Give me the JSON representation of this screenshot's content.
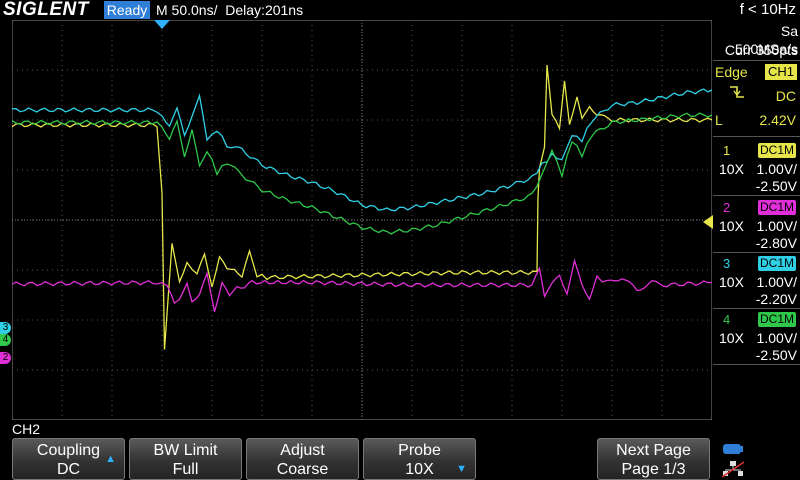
{
  "topbar": {
    "logo": "SIGLENT",
    "status": "Ready",
    "timebase": "M 50.0ns/  Delay:201ns",
    "frequency": "f < 10Hz"
  },
  "acquisition": {
    "sample_rate": "Sa 500MSa/s",
    "memory": "Curr 350pts"
  },
  "trigger": {
    "type": "Edge",
    "source": "CH1",
    "slope_icon": "falling-edge-icon",
    "coupling": "DC",
    "mode": "L",
    "level": "2.42V"
  },
  "channels": [
    {
      "num": "1",
      "coupling": "DC1M",
      "probe": "10X",
      "scale": "1.00V/",
      "offset": "-2.50V",
      "color": "#e6e64a"
    },
    {
      "num": "2",
      "coupling": "DC1M",
      "probe": "10X",
      "scale": "1.00V/",
      "offset": "-2.80V",
      "color": "#e02fd8"
    },
    {
      "num": "3",
      "coupling": "DC1M",
      "probe": "10X",
      "scale": "1.00V/",
      "offset": "-2.20V",
      "color": "#2fd0e6"
    },
    {
      "num": "4",
      "coupling": "DC1M",
      "probe": "10X",
      "scale": "1.00V/",
      "offset": "-2.50V",
      "color": "#2fc84a"
    }
  ],
  "markers": {
    "ch3": "3",
    "ch4": "4",
    "ch2": "2"
  },
  "menu": {
    "title": "CH2",
    "coupling": {
      "label": "Coupling",
      "value": "DC"
    },
    "bw_limit": {
      "label": "BW Limit",
      "value": "Full"
    },
    "adjust": {
      "label": "Adjust",
      "value": "Coarse"
    },
    "probe": {
      "label": "Probe",
      "value": "10X"
    },
    "next_page": {
      "label": "Next Page",
      "value": "Page 1/3"
    }
  },
  "icons": {
    "up_arrow": "▲",
    "down_arrow": "▼",
    "usb": "usb-icon",
    "network": "network-icon"
  },
  "chart_data": {
    "type": "line",
    "x_divisions": 14,
    "y_divisions": 8,
    "time_per_div": "50.0ns",
    "series": [
      {
        "name": "1",
        "color": "#e6e64a",
        "points": [
          [
            0,
            1.9
          ],
          [
            2.9,
            1.9
          ],
          [
            3.0,
            0.5
          ],
          [
            3.05,
            -2.6
          ],
          [
            3.2,
            -0.5
          ],
          [
            3.35,
            -1.2
          ],
          [
            3.5,
            -0.85
          ],
          [
            3.7,
            -1.1
          ],
          [
            3.85,
            -0.7
          ],
          [
            4.0,
            -1.3
          ],
          [
            4.15,
            -0.75
          ],
          [
            4.3,
            -1.0
          ],
          [
            4.45,
            -0.95
          ],
          [
            4.6,
            -1.15
          ],
          [
            4.75,
            -0.65
          ],
          [
            4.9,
            -1.1
          ],
          [
            5.1,
            -1.15
          ],
          [
            7.0,
            -1.1
          ],
          [
            9.0,
            -1.05
          ],
          [
            10.5,
            -1.05
          ],
          [
            10.52,
            0.5
          ],
          [
            10.55,
            1.0
          ],
          [
            10.65,
            1.5
          ],
          [
            10.7,
            3.1
          ],
          [
            10.8,
            2.1
          ],
          [
            10.95,
            1.8
          ],
          [
            11.05,
            2.8
          ],
          [
            11.15,
            1.9
          ],
          [
            11.3,
            2.5
          ],
          [
            11.4,
            2.0
          ],
          [
            11.55,
            2.3
          ],
          [
            11.7,
            2.1
          ],
          [
            12.0,
            2.0
          ],
          [
            14,
            2.0
          ]
        ]
      },
      {
        "name": "2",
        "color": "#e02fd8",
        "points": [
          [
            0,
            -1.28
          ],
          [
            2.9,
            -1.25
          ],
          [
            3.1,
            -1.3
          ],
          [
            3.25,
            -1.7
          ],
          [
            3.35,
            -1.55
          ],
          [
            3.5,
            -1.3
          ],
          [
            3.6,
            -1.6
          ],
          [
            3.75,
            -1.5
          ],
          [
            3.9,
            -1.1
          ],
          [
            4.05,
            -1.8
          ],
          [
            4.2,
            -1.25
          ],
          [
            4.35,
            -1.55
          ],
          [
            4.5,
            -1.3
          ],
          [
            4.65,
            -1.35
          ],
          [
            4.8,
            -1.25
          ],
          [
            6.0,
            -1.25
          ],
          [
            8.0,
            -1.3
          ],
          [
            10.4,
            -1.3
          ],
          [
            10.55,
            -1.0
          ],
          [
            10.65,
            -1.5
          ],
          [
            10.8,
            -1.3
          ],
          [
            10.95,
            -1.1
          ],
          [
            11.1,
            -1.45
          ],
          [
            11.25,
            -0.85
          ],
          [
            11.4,
            -1.3
          ],
          [
            11.55,
            -1.55
          ],
          [
            11.7,
            -1.15
          ],
          [
            11.9,
            -1.25
          ],
          [
            12.2,
            -1.15
          ],
          [
            12.5,
            -1.4
          ],
          [
            12.8,
            -1.25
          ],
          [
            13.1,
            -1.3
          ],
          [
            14,
            -1.25
          ]
        ]
      },
      {
        "name": "3",
        "color": "#2fd0e6",
        "points": [
          [
            0,
            2.2
          ],
          [
            2.8,
            2.2
          ],
          [
            3.0,
            2.1
          ],
          [
            3.15,
            1.9
          ],
          [
            3.3,
            2.2
          ],
          [
            3.45,
            1.7
          ],
          [
            3.6,
            2.1
          ],
          [
            3.75,
            2.45
          ],
          [
            3.9,
            1.6
          ],
          [
            4.1,
            1.8
          ],
          [
            4.3,
            1.5
          ],
          [
            4.6,
            1.4
          ],
          [
            5.0,
            1.1
          ],
          [
            5.5,
            0.9
          ],
          [
            6.0,
            0.75
          ],
          [
            6.5,
            0.55
          ],
          [
            7.0,
            0.3
          ],
          [
            7.5,
            0.2
          ],
          [
            8.0,
            0.25
          ],
          [
            8.5,
            0.35
          ],
          [
            9.0,
            0.45
          ],
          [
            9.5,
            0.55
          ],
          [
            10.0,
            0.7
          ],
          [
            10.4,
            0.85
          ],
          [
            10.6,
            1.1
          ],
          [
            10.8,
            1.3
          ],
          [
            11.0,
            1.2
          ],
          [
            11.2,
            1.7
          ],
          [
            11.4,
            1.6
          ],
          [
            11.6,
            2.0
          ],
          [
            12.0,
            2.3
          ],
          [
            12.5,
            2.35
          ],
          [
            13.0,
            2.45
          ],
          [
            13.5,
            2.55
          ],
          [
            14,
            2.6
          ]
        ]
      },
      {
        "name": "4",
        "color": "#2fc84a",
        "points": [
          [
            0,
            1.95
          ],
          [
            2.8,
            1.95
          ],
          [
            3.0,
            1.9
          ],
          [
            3.15,
            1.6
          ],
          [
            3.3,
            1.95
          ],
          [
            3.45,
            1.3
          ],
          [
            3.6,
            1.8
          ],
          [
            3.75,
            1.05
          ],
          [
            3.9,
            1.4
          ],
          [
            4.1,
            0.95
          ],
          [
            4.3,
            1.15
          ],
          [
            4.6,
            0.9
          ],
          [
            5.0,
            0.6
          ],
          [
            5.5,
            0.4
          ],
          [
            6.0,
            0.25
          ],
          [
            6.5,
            0.05
          ],
          [
            7.0,
            -0.15
          ],
          [
            7.5,
            -0.25
          ],
          [
            8.0,
            -0.2
          ],
          [
            8.5,
            -0.1
          ],
          [
            9.0,
            0.05
          ],
          [
            9.5,
            0.2
          ],
          [
            10.0,
            0.35
          ],
          [
            10.4,
            0.5
          ],
          [
            10.6,
            0.9
          ],
          [
            10.8,
            1.4
          ],
          [
            11.0,
            0.9
          ],
          [
            11.2,
            1.6
          ],
          [
            11.4,
            1.3
          ],
          [
            11.6,
            1.7
          ],
          [
            12.0,
            1.95
          ],
          [
            12.5,
            2.0
          ],
          [
            13.0,
            2.05
          ],
          [
            13.5,
            2.1
          ],
          [
            14,
            2.1
          ]
        ]
      }
    ]
  }
}
